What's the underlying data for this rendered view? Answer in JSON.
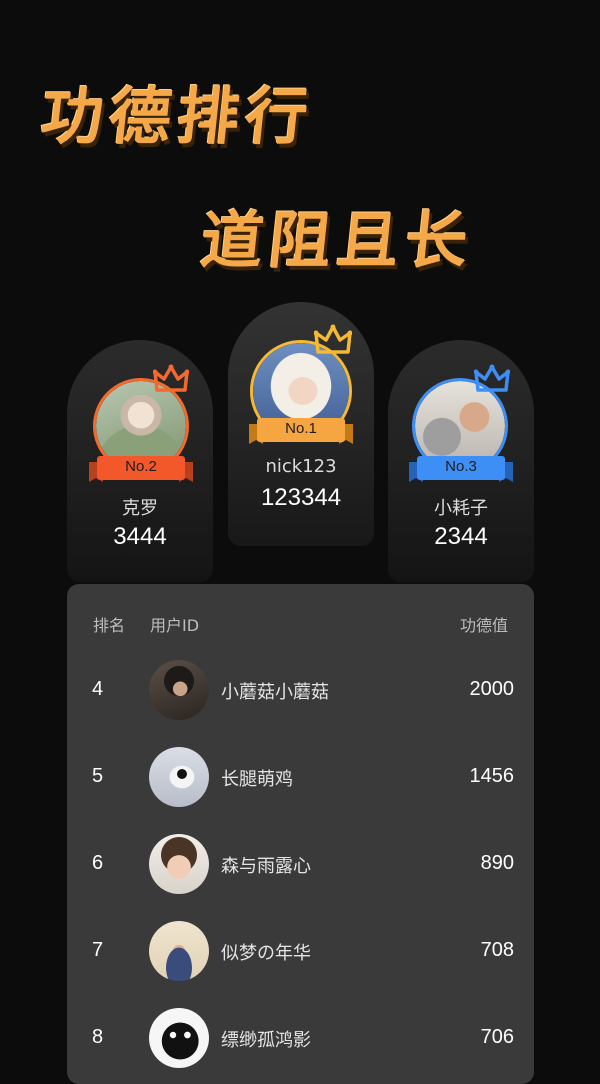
{
  "banner": {
    "title": "功德排行",
    "subtitle": "道阻且长"
  },
  "podium": [
    {
      "rank_label": "No.1",
      "name": "nick123",
      "score": "123344",
      "ribbon_color": "#f5a640",
      "crown_color": "#f5b933"
    },
    {
      "rank_label": "No.2",
      "name": "克罗",
      "score": "3444",
      "ribbon_color": "#f2582a",
      "crown_color": "#f26a2e"
    },
    {
      "rank_label": "No.3",
      "name": "小耗子",
      "score": "2344",
      "ribbon_color": "#3d8ff5",
      "crown_color": "#3d8ff5"
    }
  ],
  "leaderboard": {
    "headers": {
      "rank": "排名",
      "user": "用户ID",
      "score": "功德值"
    },
    "rows": [
      {
        "rank": "4",
        "name": "小蘑菇小蘑菇",
        "score": "2000"
      },
      {
        "rank": "5",
        "name": "长腿萌鸡",
        "score": "1456"
      },
      {
        "rank": "6",
        "name": "森与雨露心",
        "score": "890"
      },
      {
        "rank": "7",
        "name": "似梦の年华",
        "score": "708"
      },
      {
        "rank": "8",
        "name": "缥缈孤鸿影",
        "score": "706"
      }
    ]
  },
  "colors": {
    "background": "#0c0c0c",
    "banner_text": "#f5a847",
    "board": "#3a3a3a"
  }
}
